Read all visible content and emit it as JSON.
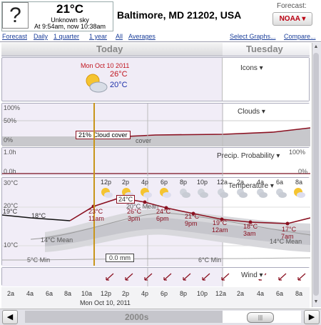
{
  "header": {
    "icon_glyph": "?",
    "temperature": "21°C",
    "sky": "Unknown sky",
    "as_of": "At 9:54am, now 10:38am",
    "location": "Baltimore, MD 21202, USA",
    "forecast_label": "Forecast:",
    "source": "NOAA ▾"
  },
  "nav": {
    "forecast": "Forecast",
    "daily": "Daily",
    "quarter": "1 quarter",
    "year": "1 year",
    "all": "All",
    "averages": "Averages",
    "select_graphs": "Select Graphs...",
    "compare": "Compare..."
  },
  "days": {
    "today": "Today",
    "tuesday": "Tuesday"
  },
  "icons_panel": {
    "label": "Icons ▾",
    "date": "Mon Oct 10 2011",
    "hi": "26°C",
    "lo": "20°C"
  },
  "clouds_panel": {
    "label": "Clouds ▾",
    "y100": "100%",
    "y50": "50%",
    "y0": "0%",
    "tooltip": "21% Cloud cover",
    "cover_text": "cover"
  },
  "precip_panel": {
    "label": "Precip. Probability ▾",
    "left_top": "1.0h",
    "left_bottom": "0.0h",
    "right_top": "100%",
    "right_bottom": "0%"
  },
  "temp_panel": {
    "label": "Temperature ▾",
    "y30": "30°C",
    "y20": "20°C",
    "y10": "10°C",
    "marker_mean": "14°C Mean",
    "marker_mean2": "14°C Mean",
    "min_left": "5°C Min",
    "min_right": "6°C Min",
    "rain_box": "0.0 mm",
    "mean20": "20°C Mean",
    "cur_left": "19°C",
    "cur_18": "18°C",
    "labels": [
      {
        "t": "23°C",
        "h": "11am"
      },
      {
        "t": "24°C",
        "h": ""
      },
      {
        "t": "26°C",
        "h": "3pm"
      },
      {
        "t": "24°C",
        "h": "6pm"
      },
      {
        "t": "21°C",
        "h": "9pm"
      },
      {
        "t": "19°C",
        "h": "12am"
      },
      {
        "t": "18°C",
        "h": "3am"
      },
      {
        "t": "17°C",
        "h": "7am"
      }
    ],
    "hours": [
      "12p",
      "2p",
      "4p",
      "6p",
      "8p",
      "10p",
      "12a",
      "2a",
      "4a",
      "6a",
      "8a"
    ]
  },
  "wind_panel": {
    "label": "Wind ▾"
  },
  "axis": {
    "ticks": [
      "2a",
      "4a",
      "6a",
      "8a",
      "10a",
      "12p",
      "2p",
      "4p",
      "6p",
      "8p",
      "10p",
      "12a",
      "2a",
      "4a",
      "6a",
      "8a"
    ],
    "date": "Mon Oct 10, 2011"
  },
  "footer": {
    "decade": "2000s",
    "left": "◀",
    "right": "▶",
    "thumb": "|||"
  },
  "colors": {
    "link": "#1a3e9a",
    "hi": "#c0141e",
    "lo": "#1c2ea8",
    "line": "#8a1020"
  }
}
